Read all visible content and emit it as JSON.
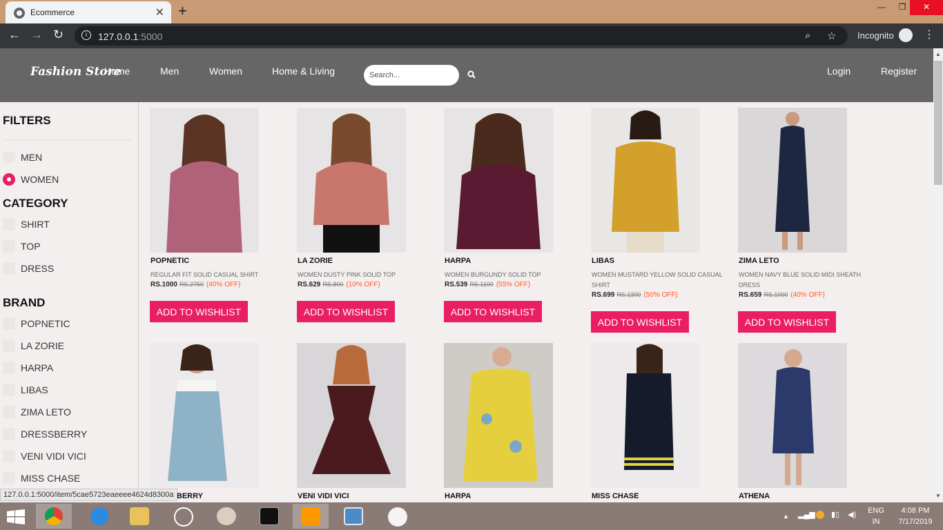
{
  "browser": {
    "tab_title": "Ecommerce",
    "url_host": "127.0.0.1",
    "url_port": ":5000",
    "profile_label": "Incognito",
    "status_url": "127.0.0.1:5000/item/5cae5723eaeeee4624d8300a"
  },
  "header": {
    "logo": "Fashion Store",
    "nav": [
      "Home",
      "Men",
      "Women",
      "Home & Living"
    ],
    "search_placeholder": "Search...",
    "login": "Login",
    "register": "Register"
  },
  "sidebar": {
    "filters_title": "FILTERS",
    "gender": [
      {
        "label": "MEN",
        "selected": false
      },
      {
        "label": "WOMEN",
        "selected": true
      }
    ],
    "category_title": "CATEGORY",
    "categories": [
      "SHIRT",
      "TOP",
      "DRESS"
    ],
    "brand_title": "BRAND",
    "brands": [
      "POPNETIC",
      "LA ZORIE",
      "HARPA",
      "LIBAS",
      "ZIMA LETO",
      "DRESSBERRY",
      "VENI VIDI VICI",
      "MISS CHASE"
    ]
  },
  "products": [
    {
      "brand": "POPNETIC",
      "name": "REGULAR FIT SOLID CASUAL SHIRT",
      "price": "RS.1000",
      "mrp": "RS.2750",
      "off": "(40% OFF)",
      "button": "ADD TO WISHLIST",
      "img_color": "#b0627a"
    },
    {
      "brand": "LA ZORIE",
      "name": "WOMEN DUSTY PINK SOLID TOP",
      "price": "RS.629",
      "mrp": "RS.800",
      "off": "(10% OFF)",
      "button": "ADD TO WISHLIST",
      "img_color": "#c9776d"
    },
    {
      "brand": "HARPA",
      "name": "WOMEN BURGUNDY SOLID TOP",
      "price": "RS.539",
      "mrp": "RS.1100",
      "off": "(55% OFF)",
      "button": "ADD TO WISHLIST",
      "img_color": "#5a1a32"
    },
    {
      "brand": "LIBAS",
      "name": "WOMEN MUSTARD YELLOW SOLID CASUAL SHIRT",
      "price": "RS.699",
      "mrp": "RS.1300",
      "off": "(50% OFF)",
      "button": "ADD TO WISHLIST",
      "img_color": "#d3a02c"
    },
    {
      "brand": "ZIMA LETO",
      "name": "WOMEN NAVY BLUE SOLID MIDI SHEATH DRESS",
      "price": "RS.659",
      "mrp": "RS.1000",
      "off": "(40% OFF)",
      "button": "ADD TO WISHLIST",
      "img_color": "#1e2742"
    },
    {
      "brand": "DRESSBERRY",
      "img_color": "#8fb3c6"
    },
    {
      "brand": "VENI VIDI VICI",
      "img_color": "#4a1a1e"
    },
    {
      "brand": "HARPA",
      "img_color": "#e5cf3f"
    },
    {
      "brand": "MISS CHASE",
      "img_color": "#151b2b"
    },
    {
      "brand": "ATHENA",
      "img_color": "#2c3a6b"
    }
  ],
  "taskbar": {
    "lang_top": "ENG",
    "lang_bottom": "IN",
    "time": "4:08 PM",
    "date": "7/17/2019"
  },
  "colors": {
    "accent": "#e91e63",
    "header_bg": "#666666",
    "page_bg": "#f4efef",
    "discount": "#ff5722"
  }
}
